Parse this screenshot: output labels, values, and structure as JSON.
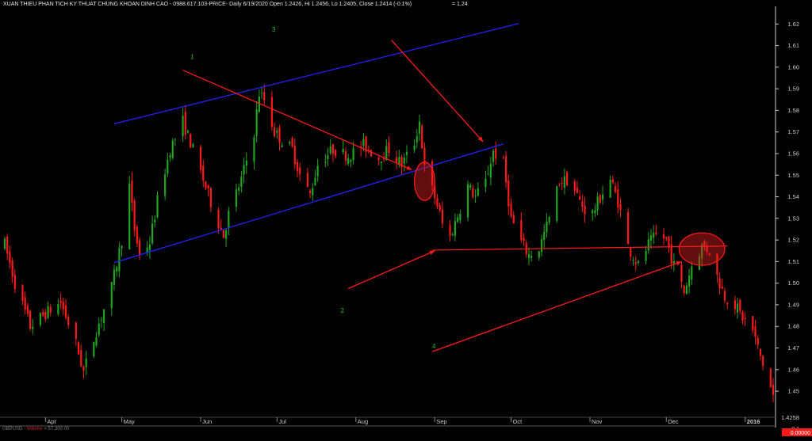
{
  "header": {
    "title": "XUAN THIEU PHAN TICH KY THUAT CHUNG KHOAN DINH CAO - 0988.617.103-PRICE- Daily 6/19/2020 Open 1.2426, Hi 1.2456, Lo 1.2405, Close 1.2414 (-0.1%)",
    "value": "= 1.24"
  },
  "volume_label": {
    "symbol": "GBPUSD",
    "name": "Volume",
    "value": "= 57,300.00"
  },
  "colors": {
    "bull": "#1fa61f",
    "bear": "#ff1a1a",
    "channel": "#2323ff",
    "arrow": "#ff1a1a",
    "note": "#1fc21f",
    "axis": "#cccccc"
  },
  "chart_data": {
    "type": "candlestick",
    "ylim": [
      1.4405,
      1.6245
    ],
    "yticks": [
      "1.62",
      "1.61",
      "1.60",
      "1.59",
      "1.58",
      "1.57",
      "1.56",
      "1.55",
      "1.54",
      "1.53",
      "1.52",
      "1.51",
      "1.50",
      "1.49",
      "1.48",
      "1.47",
      "1.46",
      "1.45"
    ],
    "current_price": "1.4258",
    "last_price_tag": "0.00000",
    "volume_axis_label": "0.1",
    "xticks": [
      "Apr",
      "May",
      "Jun",
      "Jul",
      "Aug",
      "Sep",
      "Oct",
      "Nov",
      "Dec",
      "2016"
    ],
    "x_range": {
      "start": "2015-03-16",
      "end": "2016-01-12"
    },
    "month_starts": [
      "2015-04-01",
      "2015-05-01",
      "2015-06-01",
      "2015-07-01",
      "2015-08-01",
      "2015-09-01",
      "2015-10-01",
      "2015-11-01",
      "2015-12-01",
      "2016-01-01"
    ],
    "price_path": [
      [
        "2015-03-16",
        1.518
      ],
      [
        "2015-03-20",
        1.5
      ],
      [
        "2015-03-26",
        1.48
      ],
      [
        "2015-04-01",
        1.486
      ],
      [
        "2015-04-07",
        1.491
      ],
      [
        "2015-04-13",
        1.472
      ],
      [
        "2015-04-16",
        1.459
      ],
      [
        "2015-04-21",
        1.478
      ],
      [
        "2015-04-27",
        1.498
      ],
      [
        "2015-05-01",
        1.52
      ],
      [
        "2015-05-04",
        1.545
      ],
      [
        "2015-05-06",
        1.525
      ],
      [
        "2015-05-08",
        1.513
      ],
      [
        "2015-05-12",
        1.519
      ],
      [
        "2015-05-15",
        1.538
      ],
      [
        "2015-05-20",
        1.562
      ],
      [
        "2015-05-25",
        1.575
      ],
      [
        "2015-05-28",
        1.565
      ],
      [
        "2015-06-02",
        1.548
      ],
      [
        "2015-06-06",
        1.534
      ],
      [
        "2015-06-10",
        1.522
      ],
      [
        "2015-06-12",
        1.532
      ],
      [
        "2015-06-17",
        1.548
      ],
      [
        "2015-06-22",
        1.57
      ],
      [
        "2015-06-24",
        1.588
      ],
      [
        "2015-06-26",
        1.585
      ],
      [
        "2015-06-30",
        1.57
      ],
      [
        "2015-07-03",
        1.566
      ],
      [
        "2015-07-07",
        1.562
      ],
      [
        "2015-07-10",
        1.55
      ],
      [
        "2015-07-14",
        1.541
      ],
      [
        "2015-07-17",
        1.555
      ],
      [
        "2015-07-23",
        1.562
      ],
      [
        "2015-07-29",
        1.559
      ],
      [
        "2015-08-04",
        1.564
      ],
      [
        "2015-08-10",
        1.558
      ],
      [
        "2015-08-14",
        1.562
      ],
      [
        "2015-08-19",
        1.555
      ],
      [
        "2015-08-24",
        1.565
      ],
      [
        "2015-08-26",
        1.575
      ],
      [
        "2015-08-28",
        1.553
      ],
      [
        "2015-09-01",
        1.54
      ],
      [
        "2015-09-03",
        1.532
      ],
      [
        "2015-09-06",
        1.518
      ],
      [
        "2015-09-09",
        1.528
      ],
      [
        "2015-09-14",
        1.545
      ],
      [
        "2015-09-17",
        1.54
      ],
      [
        "2015-09-21",
        1.547
      ],
      [
        "2015-09-24",
        1.561
      ],
      [
        "2015-09-28",
        1.555
      ],
      [
        "2015-10-01",
        1.53
      ],
      [
        "2015-10-05",
        1.519
      ],
      [
        "2015-10-08",
        1.513
      ],
      [
        "2015-10-12",
        1.516
      ],
      [
        "2015-10-16",
        1.53
      ],
      [
        "2015-10-20",
        1.547
      ],
      [
        "2015-10-24",
        1.548
      ],
      [
        "2015-10-28",
        1.538
      ],
      [
        "2015-11-01",
        1.53
      ],
      [
        "2015-11-06",
        1.542
      ],
      [
        "2015-11-09",
        1.548
      ],
      [
        "2015-11-12",
        1.538
      ],
      [
        "2015-11-16",
        1.517
      ],
      [
        "2015-11-20",
        1.508
      ],
      [
        "2015-11-24",
        1.518
      ],
      [
        "2015-11-28",
        1.523
      ],
      [
        "2015-12-01",
        1.52
      ],
      [
        "2015-12-04",
        1.508
      ],
      [
        "2015-12-08",
        1.496
      ],
      [
        "2015-12-11",
        1.508
      ],
      [
        "2015-12-15",
        1.517
      ],
      [
        "2015-12-18",
        1.515
      ],
      [
        "2015-12-21",
        1.503
      ],
      [
        "2015-12-24",
        1.494
      ],
      [
        "2015-12-28",
        1.49
      ],
      [
        "2015-12-31",
        1.484
      ],
      [
        "2016-01-04",
        1.478
      ],
      [
        "2016-01-07",
        1.466
      ],
      [
        "2016-01-12",
        1.448
      ]
    ],
    "channel_lines": [
      [
        [
          "2015-04-28",
          1.5738
        ],
        [
          "2015-10-04",
          1.6202
        ]
      ],
      [
        [
          "2015-04-28",
          1.5095
        ],
        [
          "2015-09-28",
          1.5645
        ]
      ]
    ],
    "support_line": [
      [
        "2015-08-31",
        1.5153
      ],
      [
        "2015-12-25",
        1.5172
      ]
    ],
    "arrows": [
      [
        [
          "2015-05-25",
          1.5986
        ],
        [
          "2015-08-23",
          1.5525
        ]
      ],
      [
        [
          "2015-08-15",
          1.6125
        ],
        [
          "2015-09-20",
          1.5655
        ]
      ],
      [
        [
          "2015-07-29",
          1.4975
        ],
        [
          "2015-09-01",
          1.515
        ]
      ],
      [
        [
          "2015-08-31",
          1.4683
        ],
        [
          "2015-12-07",
          1.51
        ]
      ]
    ],
    "ellipses": [
      {
        "center": [
          "2015-08-28",
          1.5472
        ],
        "rx_days": 4,
        "ry": 0.0089
      },
      {
        "center": [
          "2015-12-15",
          1.5158
        ],
        "rx_days": 9,
        "ry": 0.0075
      }
    ],
    "annotations": [
      {
        "text": "1",
        "at": [
          "2015-05-28",
          1.6038
        ]
      },
      {
        "text": "2",
        "at": [
          "2015-07-26",
          1.4863
        ]
      },
      {
        "text": "3",
        "at": [
          "2015-06-29",
          1.6164
        ]
      },
      {
        "text": "4",
        "at": [
          "2015-08-31",
          1.4698
        ]
      }
    ]
  }
}
